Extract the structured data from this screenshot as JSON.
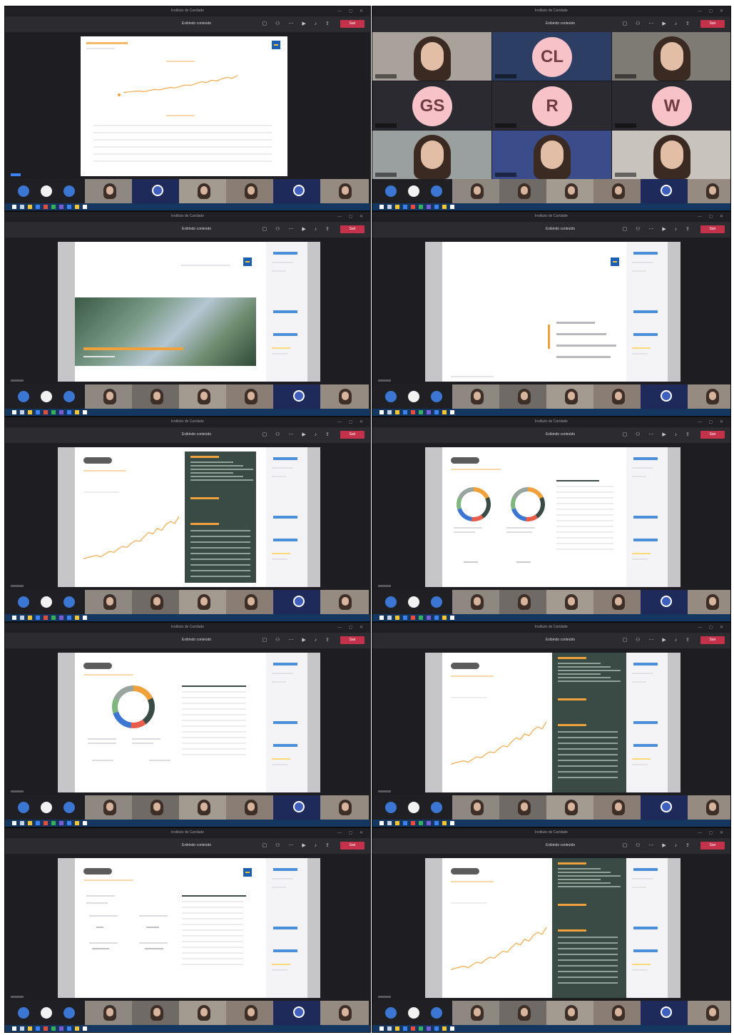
{
  "meeting": {
    "window_title": "Instituto de Caridade",
    "presenter_label": "Exibindo conteúdo",
    "leave_label": "Sair"
  },
  "avatars": [
    "CL",
    "GS",
    "R",
    "W"
  ],
  "colors": {
    "teams_dark": "#1b1b1f",
    "leave_red": "#c4314b",
    "taskbar_blue": "#15365f",
    "slide_orange": "#f0a13c",
    "slide_green_panel": "#3a4a44",
    "avatar_pink": "#f7c3c8",
    "avatar_text": "#6e3e42",
    "brand_blue": "#1a5fb4"
  },
  "icons": {
    "titlebar": "window-controls",
    "toolbar": [
      "chat-icon",
      "people-icon",
      "more-icon",
      "camera-icon",
      "mic-icon",
      "share-icon"
    ],
    "strip": [
      "person-circle-icon",
      "person-circle-icon",
      "person-circle-icon"
    ],
    "taskbar": [
      "windows-start-icon",
      "search-icon",
      "file-explorer-icon",
      "browser-icon",
      "teams-icon",
      "mail-icon"
    ]
  }
}
